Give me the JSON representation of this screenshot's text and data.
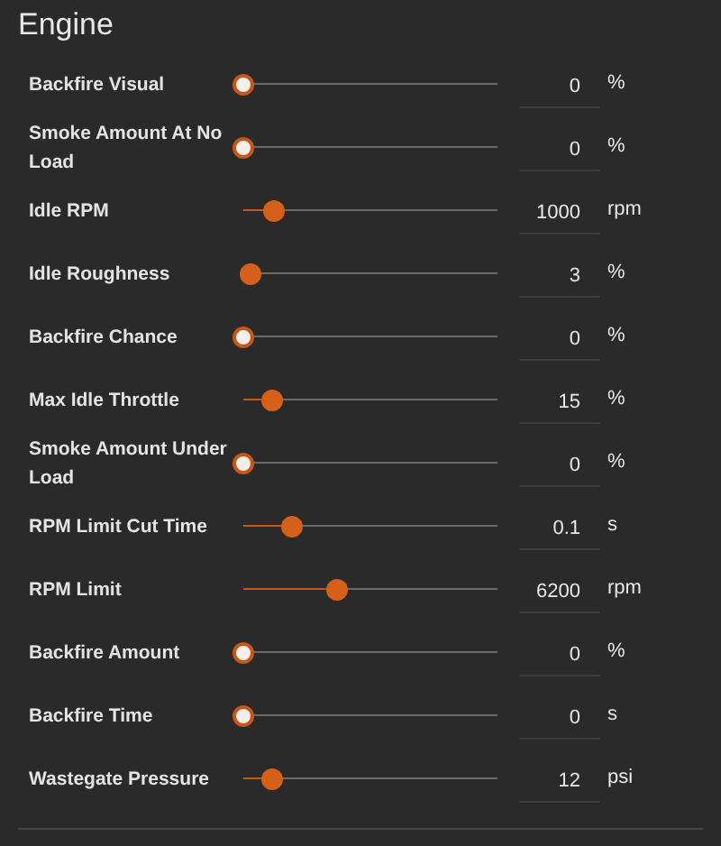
{
  "section": {
    "title": "Engine"
  },
  "settings": [
    {
      "label": "Backfire Visual",
      "level": 0,
      "value": "0",
      "unit": "%"
    },
    {
      "label": "Smoke Amount At No Load",
      "level": 0,
      "value": "0",
      "unit": "%"
    },
    {
      "label": "Idle RPM",
      "level": 0.12,
      "value": "1000",
      "unit": "rpm"
    },
    {
      "label": "Idle Roughness",
      "level": 0.03,
      "value": "3",
      "unit": "%"
    },
    {
      "label": "Backfire Chance",
      "level": 0,
      "value": "0",
      "unit": "%"
    },
    {
      "label": "Max Idle Throttle",
      "level": 0.11,
      "value": "15",
      "unit": "%"
    },
    {
      "label": "Smoke Amount Under Load",
      "level": 0,
      "value": "0",
      "unit": "%"
    },
    {
      "label": "RPM Limit Cut Time",
      "level": 0.19,
      "value": "0.1",
      "unit": "s"
    },
    {
      "label": "RPM Limit",
      "level": 0.37,
      "value": "6200",
      "unit": "rpm"
    },
    {
      "label": "Backfire Amount",
      "level": 0,
      "value": "0",
      "unit": "%"
    },
    {
      "label": "Backfire Time",
      "level": 0,
      "value": "0",
      "unit": "s"
    },
    {
      "label": "Wastegate Pressure",
      "level": 0.11,
      "value": "12",
      "unit": "psi"
    }
  ]
}
